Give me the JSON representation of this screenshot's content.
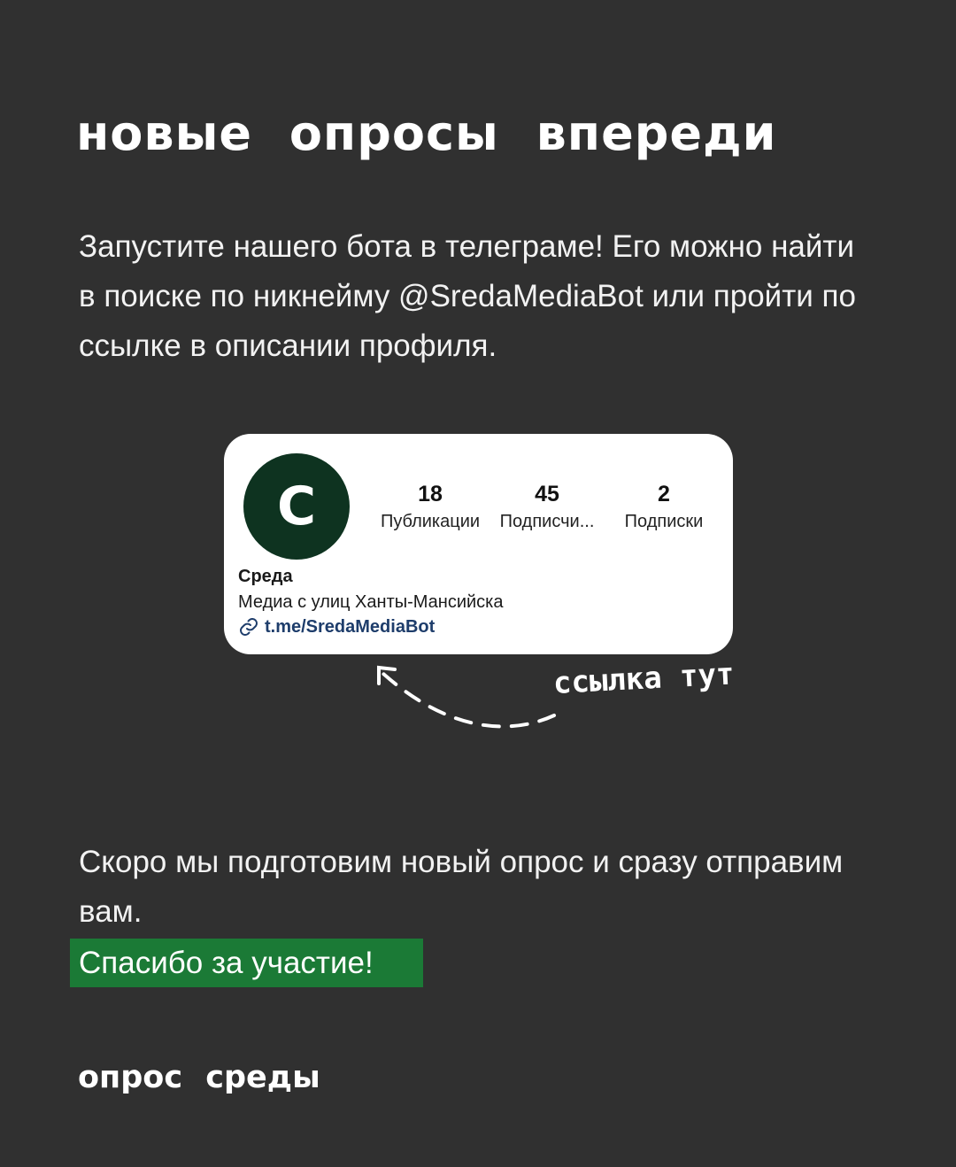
{
  "title": "новые опросы впереди",
  "intro": "Запустите нашего бота в телеграме! Его можно найти в поиске по никнейму @SredaMediaBot или пройти по ссылке в описании профиля.",
  "profile_card": {
    "avatar_letter": "С",
    "avatar_color": "#0e3320",
    "stats": [
      {
        "value": "18",
        "label": "Публикации"
      },
      {
        "value": "45",
        "label": "Подписчи..."
      },
      {
        "value": "2",
        "label": "Подписки"
      }
    ],
    "name": "Среда",
    "bio": "Медиа с улиц Ханты-Мансийска",
    "link_text": "t.me/SredaMediaBot",
    "link_icon": "link-icon",
    "link_color": "#1e3d6b"
  },
  "annotation": {
    "label": "ссылка тут",
    "icon": "dashed-arrow-icon"
  },
  "outro": "Скоро мы подготовим новый опрос и сразу отправим вам.",
  "thanks": "Спасибо за участие!",
  "footer": "опрос среды",
  "colors": {
    "background": "#303030",
    "accent_green": "#1b7a36",
    "text": "#ffffff"
  }
}
